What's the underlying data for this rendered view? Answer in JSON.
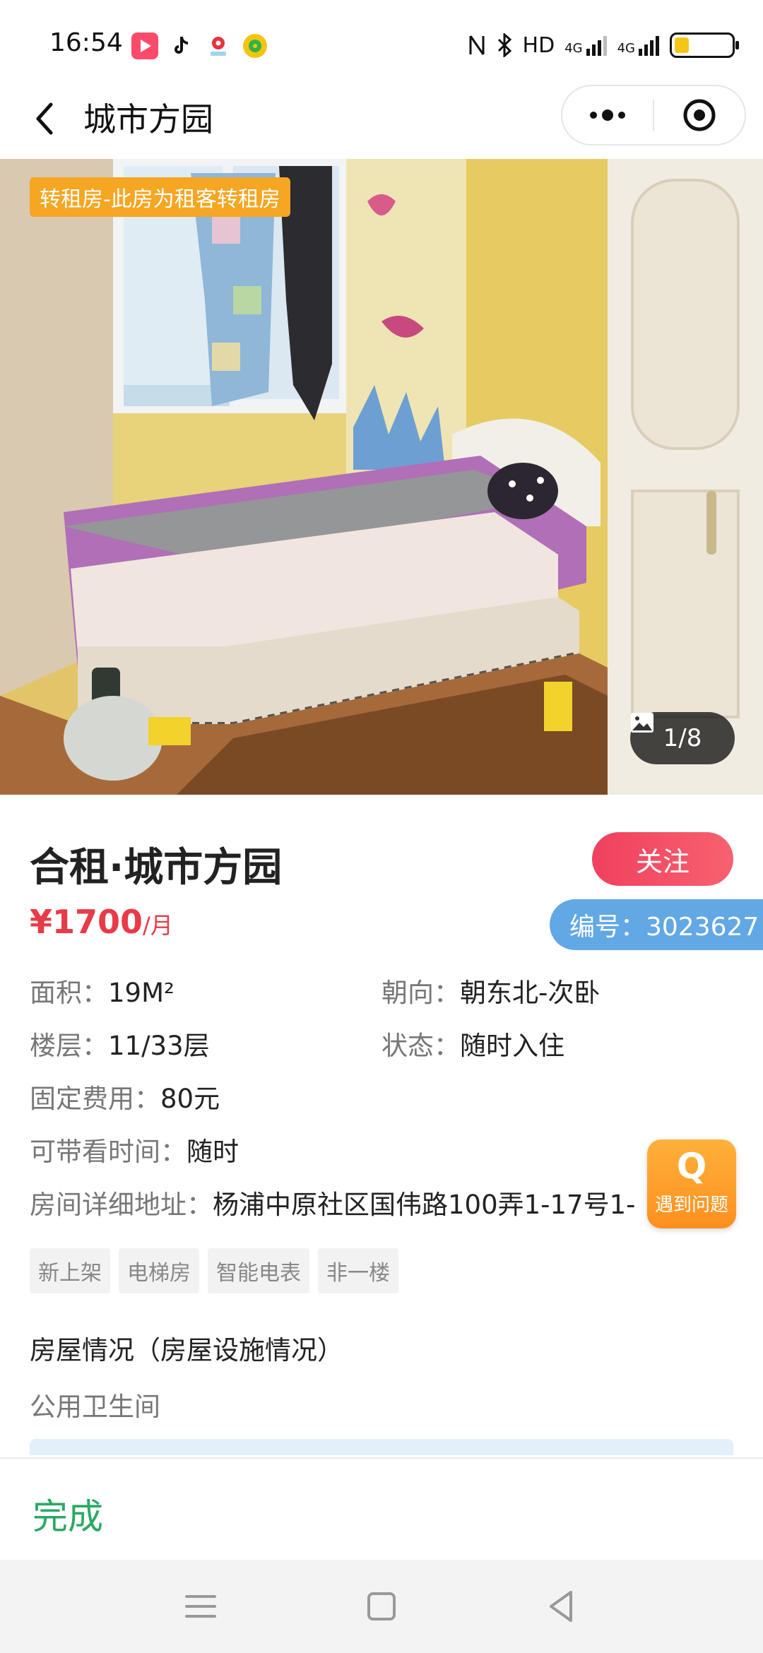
{
  "status_bar": {
    "time": "16:54",
    "app_icons": [
      "video-app-icon",
      "tiktok-icon",
      "map-pin-app-icon",
      "music-app-icon"
    ],
    "system_text": "HD",
    "network_labels": [
      "4G",
      "4G"
    ],
    "battery_level": 0.25
  },
  "header": {
    "title": "城市方园"
  },
  "gallery": {
    "sublet_tag": "转租房-此房为租客转租房",
    "counter": "1/8"
  },
  "listing": {
    "title": "合租·城市方园",
    "follow_label": "关注",
    "price_amount": "¥1700",
    "price_unit": "/月",
    "id_label": "编号：3023627",
    "attributes": {
      "area_key": "面积：",
      "area_val": "19M²",
      "orientation_key": "朝向：",
      "orientation_val": "朝东北-次卧",
      "floor_key": "楼层：",
      "floor_val": "11/33层",
      "status_key": "状态：",
      "status_val": "随时入住",
      "fee_key": "固定费用：",
      "fee_val": "80元",
      "viewing_key": "可带看时间：",
      "viewing_val": "随时",
      "address_key": "房间详细地址：",
      "address_val": "杨浦中原社区国伟路100弄1-17号1-"
    },
    "tags": [
      "新上架",
      "电梯房",
      "智能电表",
      "非一楼"
    ],
    "section_title": "房屋情况（房屋设施情况）",
    "section_item": "公用卫生间"
  },
  "help_button": {
    "icon_text": "Q",
    "label": "遇到问题"
  },
  "footer": {
    "done_label": "完成"
  },
  "colors": {
    "price": "#e83b47",
    "follow": "#f0405f",
    "id_badge": "#62a8e5",
    "done": "#2aa865",
    "help": "#ff9a26",
    "tag": "#f5a623"
  }
}
